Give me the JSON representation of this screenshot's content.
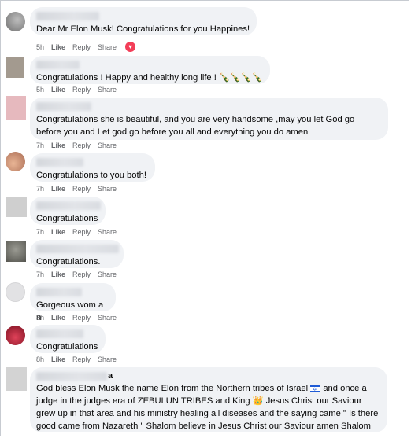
{
  "actions": {
    "like": "Like",
    "reply": "Reply",
    "share": "Share"
  },
  "comments": [
    {
      "time": "5h",
      "text": "Dear Mr Elon Musk! Congratulations for you Happines!",
      "reaction": "love-reaction-icon",
      "avatar_color": "#8a8c8f"
    },
    {
      "time": "5h",
      "text": "Congratulations ! Happy and healthy long life ! 🍾🍾🍾🍾",
      "avatar_color": "#a39a8f"
    },
    {
      "time": "7h",
      "text": "Congratulations she is beautiful, and you are very handsome ,may you let God go before you and Let god go before you all and everything you do amen",
      "avatar_color": "#e6b9be"
    },
    {
      "time": "7h",
      "text": "Congratulations to you both!",
      "avatar_color": "#c99479"
    },
    {
      "time": "7h",
      "text": "Congratulations",
      "avatar_color": "#c9c9c9"
    },
    {
      "time": "7h",
      "text": "Congratulations.",
      "avatar_color": "#6e6e6a"
    },
    {
      "time": "8h",
      "text": "Gorgeous wom a n",
      "avatar_color": "#d8d8da"
    },
    {
      "time": "8h",
      "text": "Congratulations",
      "avatar_color": "#c1273a"
    },
    {
      "time": "",
      "name_suffix": "a",
      "text_parts": [
        "God bless Elon Musk the name Elon from the Northern tribes of Israel ",
        " and once a judge in the judges era of ZEBULUN TRIBES and King 👑 Jesus Christ our Saviour grew up in that area and his ministry healing all diseases and the saying came \" Is there good came from Nazareth \" Shalom believe in Jesus Christ our Saviour amen Shalom"
      ],
      "avatar_color": "#d3d3d3"
    }
  ]
}
